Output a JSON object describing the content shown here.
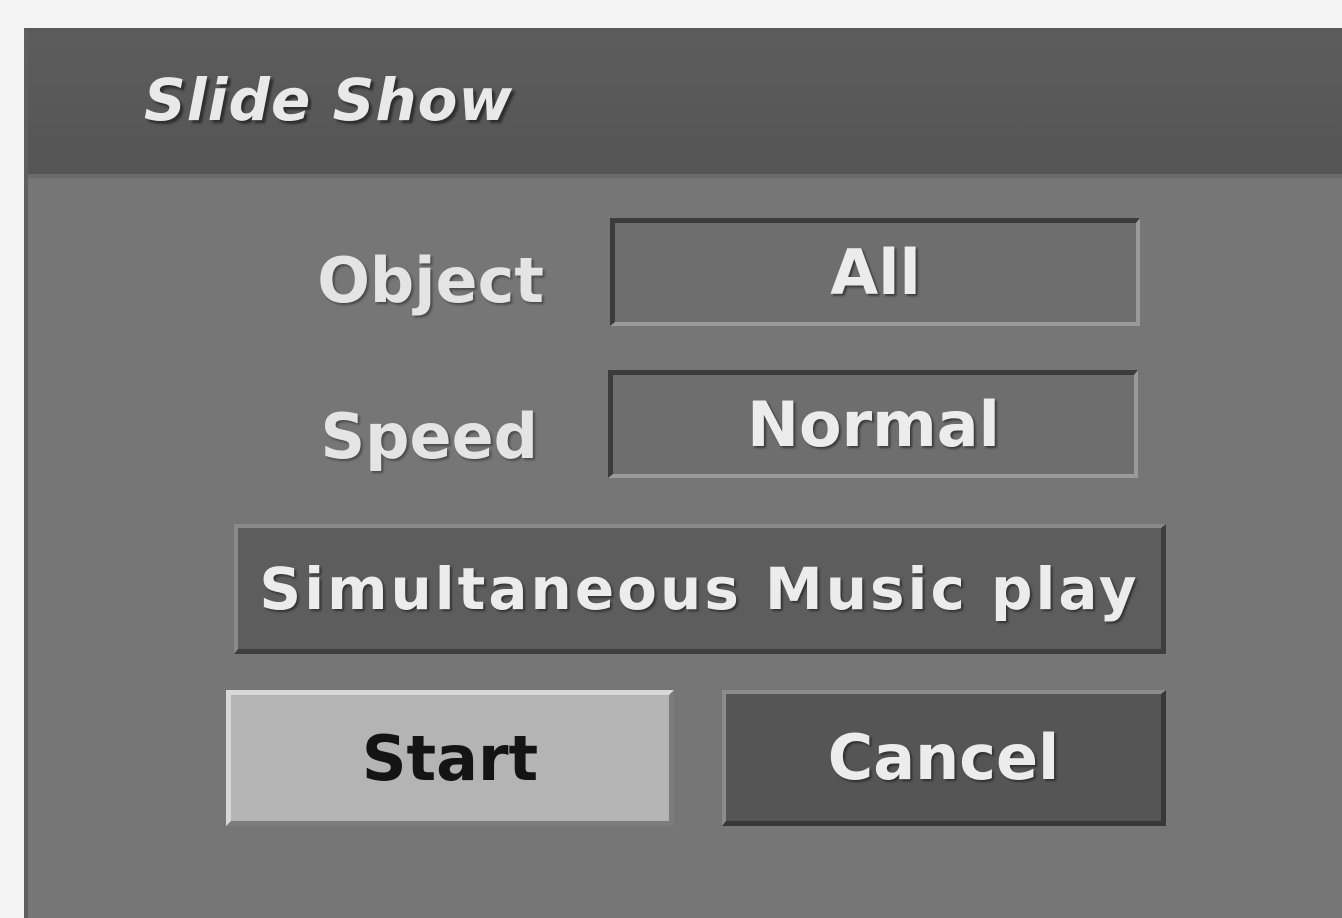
{
  "dialog": {
    "title": "Slide Show"
  },
  "fields": {
    "object": {
      "label": "Object",
      "value": "All"
    },
    "speed": {
      "label": "Speed",
      "value": "Normal"
    }
  },
  "buttons": {
    "music_label": "Simultaneous Music play",
    "start_label": "Start",
    "cancel_label": "Cancel"
  },
  "colors": {
    "dialog_bg": "#767676",
    "titlebar_bg": "#575757",
    "focused_button_bg": "#b4b4b4",
    "button_bg": "#555555",
    "text": "#ececec"
  }
}
